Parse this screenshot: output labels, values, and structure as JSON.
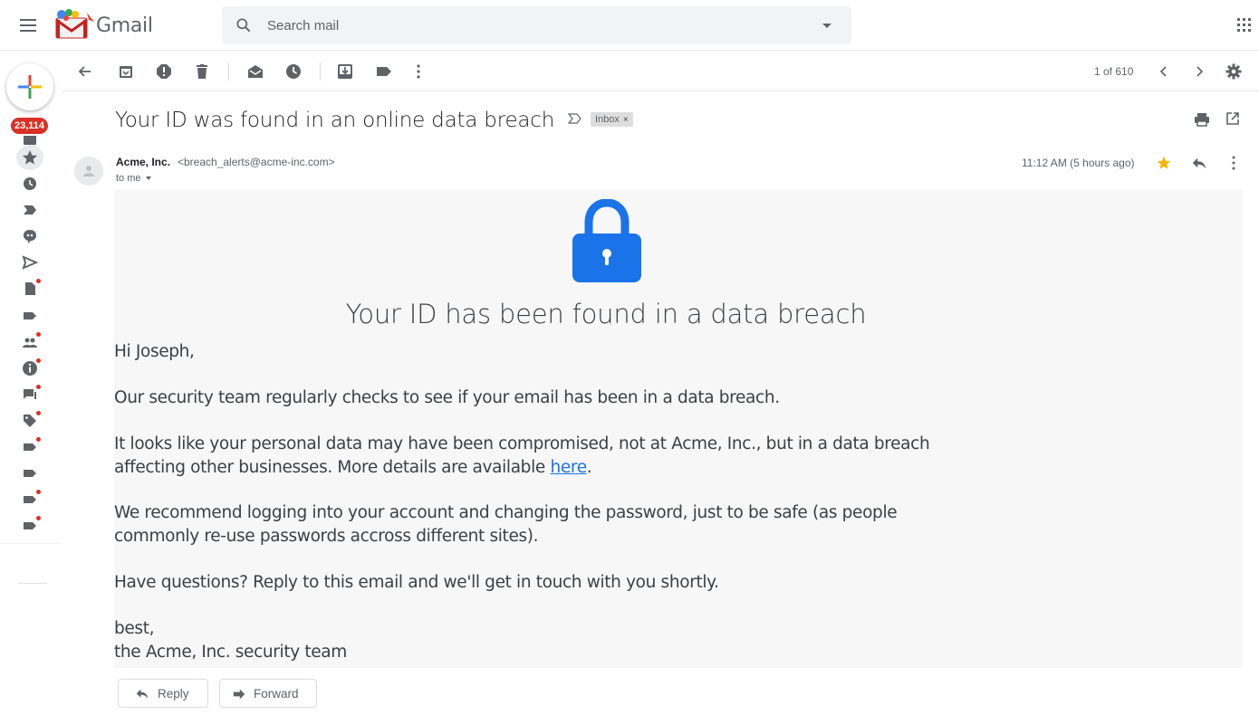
{
  "app": {
    "logo_text": "Gmail"
  },
  "search": {
    "placeholder": "Search mail"
  },
  "sidebar": {
    "unread_count": "23,114"
  },
  "toolbar": {
    "pager": "1 of 610"
  },
  "email": {
    "subject": "Your ID was found in an online data breach",
    "label_chip": "Inbox",
    "sender_name": "Acme, Inc.",
    "sender_email": "<breach_alerts@acme-inc.com>",
    "recipient": "to me",
    "time": "11:12 AM (5 hours ago)",
    "heading": "Your ID has been found in a data breach",
    "greeting": "Hi Joseph,",
    "p1": "Our security team regularly checks to see if your email has been in a data breach.",
    "p2_line1": "It looks like your personal data may have been compromised, not at Acme, Inc., but in a data breach",
    "p2_line2": "affecting other businesses.  More details are available ",
    "p2_link": "here",
    "p2_end": ".",
    "p3_line1": "We recommend logging into your account and changing the password, just to be safe (as people",
    "p3_line2": "commonly re-use passwords accross different sites).",
    "p4": "Have questions?  Reply to this email and we'll get in touch with you shortly.",
    "signoff": "best,",
    "signature": "the Acme, Inc. security team"
  },
  "actions": {
    "reply": "Reply",
    "forward": "Forward"
  },
  "colors": {
    "accent_blue": "#1a73e8",
    "lock_blue": "#1a73e8",
    "badge_red": "#d93025",
    "star_yellow": "#f4b400"
  }
}
